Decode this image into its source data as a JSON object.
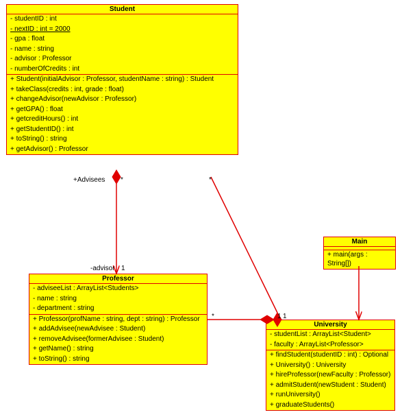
{
  "classes": {
    "student": {
      "name": "Student",
      "attrs": [
        "- studentID : int",
        "- nextID : int = 2000",
        "- gpa : float",
        "- name : string",
        "- advisor : Professor",
        "- numberOfCredits : int"
      ],
      "ops": [
        "+ Student(initialAdvisor : Professor, studentName : string) : Student",
        "+ takeClass(credits : int, grade : float)",
        "+ changeAdvisor(newAdvisor : Professor)",
        "+ getGPA() : float",
        "+ getcreditHours() : int",
        "+ getStudentID() : int",
        "+ toString() : string",
        "+ getAdvisor() : Professor"
      ]
    },
    "professor": {
      "name": "Professor",
      "attrs": [
        "- adviseeList : ArrayList<Students>",
        "- name : string",
        "- department : string"
      ],
      "ops": [
        "+ Professor(profName : string, dept : string) : Professor",
        "+ addAdvisee(newAdvisee : Student)",
        "+ removeAdvisee(formerAdvisee : Student)",
        "+ getName() : string",
        "+ toString() : string"
      ]
    },
    "university": {
      "name": "University",
      "attrs": [
        "- studentList : ArrayList<Student>",
        "- faculty : ArrayList<Professor>"
      ],
      "ops": [
        "+ findStudent(studentID : int) : Optional",
        "+ University() : University",
        "+ hireProfessor(newFaculty : Professor)",
        "+ admitStudent(newStudent : Student)",
        "+ runUniversity()",
        "+ graduateStudents()"
      ]
    },
    "main": {
      "name": "Main",
      "ops": [
        "+ main(args : String[])"
      ]
    }
  },
  "labels": {
    "advisees_role": "+Advisees",
    "advisees_mult": "*",
    "advisor_role": "-advisor",
    "advisor_mult": "1",
    "prof_univ_star": "*",
    "prof_univ_one": "1",
    "stud_univ_star": "*",
    "stud_univ_one": "1"
  }
}
